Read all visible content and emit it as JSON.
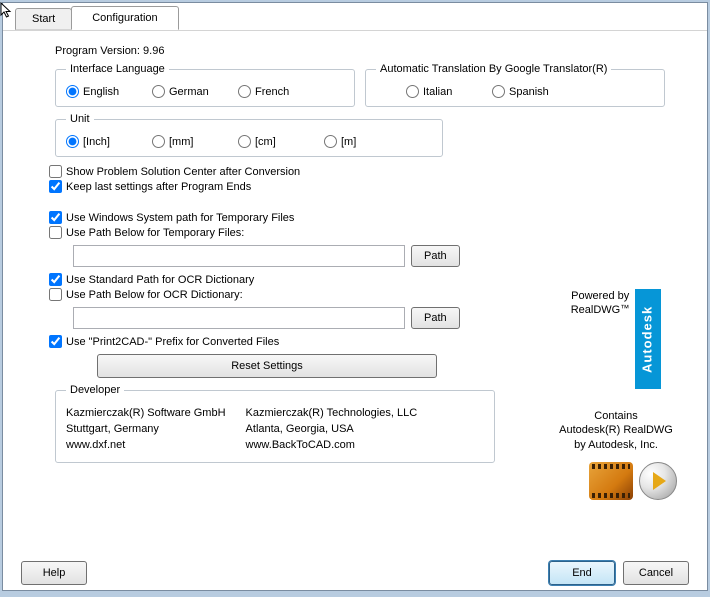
{
  "tabs": {
    "start": "Start",
    "configuration": "Configuration"
  },
  "version_label": "Program Version: 9.96",
  "lang": {
    "legend": "Interface Language",
    "english": "English",
    "german": "German",
    "french": "French"
  },
  "trans": {
    "legend": "Automatic Translation By Google Translator(R)",
    "italian": "Italian",
    "spanish": "Spanish"
  },
  "unit": {
    "legend": "Unit",
    "inch": "[Inch]",
    "mm": "[mm]",
    "cm": "[cm]",
    "m": "[m]"
  },
  "checks": {
    "show_problem": "Show Problem Solution Center after Conversion",
    "keep_last": "Keep last settings after Program Ends",
    "use_win_temp": "Use Windows System path for Temporary Files",
    "use_below_temp": "Use Path Below for Temporary Files:",
    "use_std_ocr": "Use Standard Path for OCR Dictionary",
    "use_below_ocr": "Use Path Below for OCR Dictionary:",
    "use_prefix": "Use \"Print2CAD-\" Prefix for Converted Files"
  },
  "buttons": {
    "path": "Path",
    "reset": "Reset Settings",
    "help": "Help",
    "end": "End",
    "cancel": "Cancel"
  },
  "developer": {
    "legend": "Developer",
    "col1": {
      "name": "Kazmierczak(R) Software GmbH",
      "addr": "Stuttgart, Germany",
      "url": "www.dxf.net"
    },
    "col2": {
      "name": "Kazmierczak(R) Technologies, LLC",
      "addr": "Atlanta, Georgia, USA",
      "url": "www.BackToCAD.com"
    }
  },
  "right": {
    "powered": "Powered by",
    "realdwg": "RealDWG",
    "tm": "™",
    "autodesk": "Autodesk",
    "contains_l1": "Contains",
    "contains_l2": "Autodesk(R) RealDWG",
    "contains_l3": "by Autodesk, Inc."
  },
  "paths": {
    "temp": "",
    "ocr": ""
  }
}
